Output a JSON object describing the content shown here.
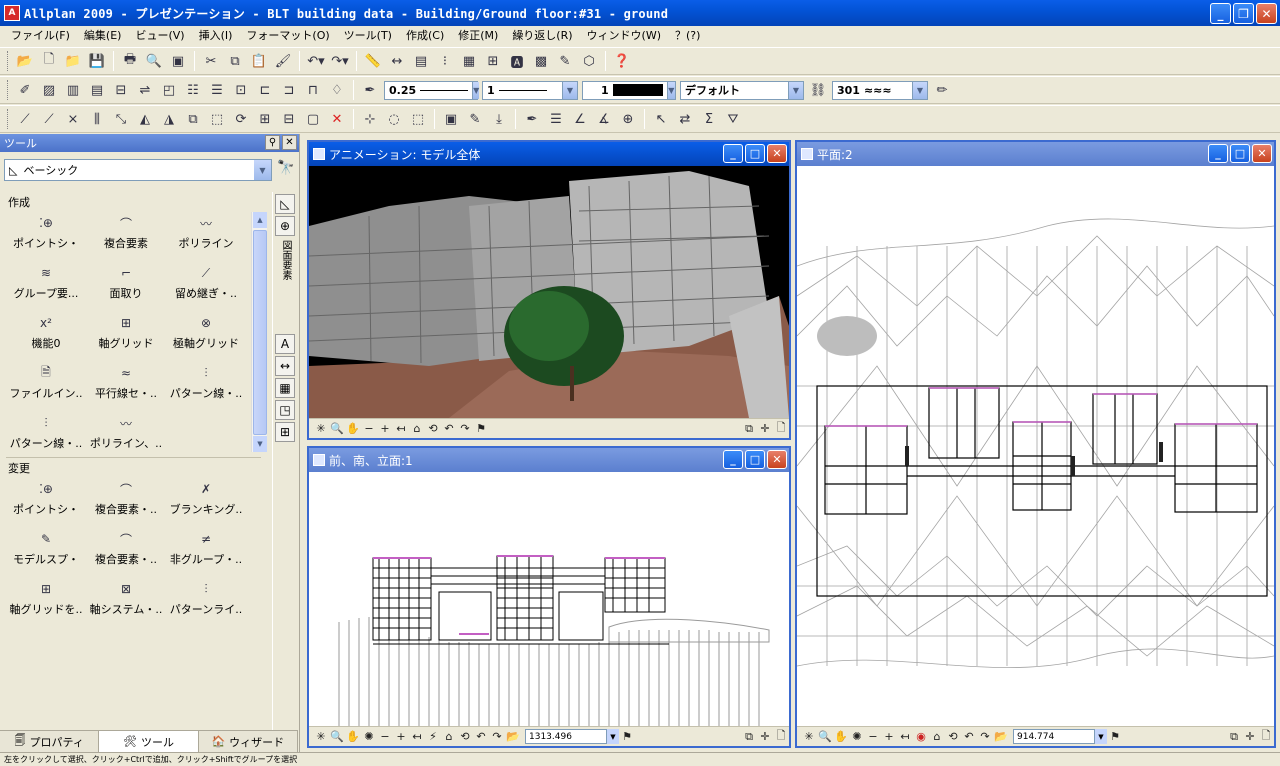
{
  "window": {
    "title": "Allplan 2009 - プレゼンテーション - BLT building data - Building/Ground floor:#31 - ground",
    "minimize": "_",
    "restore": "❐",
    "close": "✕"
  },
  "menu": [
    "ファイル(F)",
    "編集(E)",
    "ビュー(V)",
    "挿入(I)",
    "フォーマット(O)",
    "ツール(T)",
    "作成(C)",
    "修正(M)",
    "繰り返し(R)",
    "ウィンドウ(W)",
    "？(?)"
  ],
  "format_bar": {
    "pen_thickness": "0.25",
    "line_type": "1",
    "color": "1",
    "layer": "デフォルト",
    "pattern": "301"
  },
  "tool_panel": {
    "header": "ツール",
    "family": "ベーシック",
    "section_create": "作成",
    "create_tools": [
      "ポイントシ・",
      "複合要素",
      "ポリライン",
      "グループ要...",
      "面取り",
      "留め継ぎ・..",
      "機能0",
      "軸グリッド",
      "極軸グリッド",
      "ファイルイン..",
      "平行線セ・..",
      "パターン線・..",
      "パターン線・..",
      "ポリライン、.."
    ],
    "create_icons": [
      "point-symbol-icon",
      "composite-element-icon",
      "polyline-icon",
      "group-icon",
      "chamfer-icon",
      "miter-icon",
      "x2-icon",
      "axis-grid-icon",
      "polar-grid-icon",
      "file-insert-icon",
      "parallel-lines-icon",
      "pattern-line-icon",
      "pattern-line-icon",
      "polyline-icon"
    ],
    "section_modify": "変更",
    "modify_tools": [
      "ポイントシ・",
      "複合要素・..",
      "ブランキング..",
      "モデルスプ・",
      "複合要素・..",
      "非グループ・..",
      "軸グリッドを..",
      "軸システム・..",
      "パターンライ.."
    ],
    "modify_icons": [
      "point-symbol-icon",
      "composite-element-icon",
      "blanking-icon",
      "model-split-icon",
      "composite-element-icon",
      "ungroup-icon",
      "axis-grid-icon",
      "axis-system-icon",
      "pattern-line-icon"
    ],
    "side_label": "図面要素",
    "tabs": [
      "プロパティ",
      "ツール",
      "ウィザード"
    ]
  },
  "viewports": {
    "animation": {
      "title": "アニメーション: モデル全体"
    },
    "elevation": {
      "title": "前、南、立面:1",
      "zoom": "1313.496"
    },
    "plan": {
      "title": "平面:2",
      "zoom": "914.774"
    }
  },
  "status": "左をクリックして選択、クリック+Ctrlで追加、クリック+Shiftでグループを選択"
}
